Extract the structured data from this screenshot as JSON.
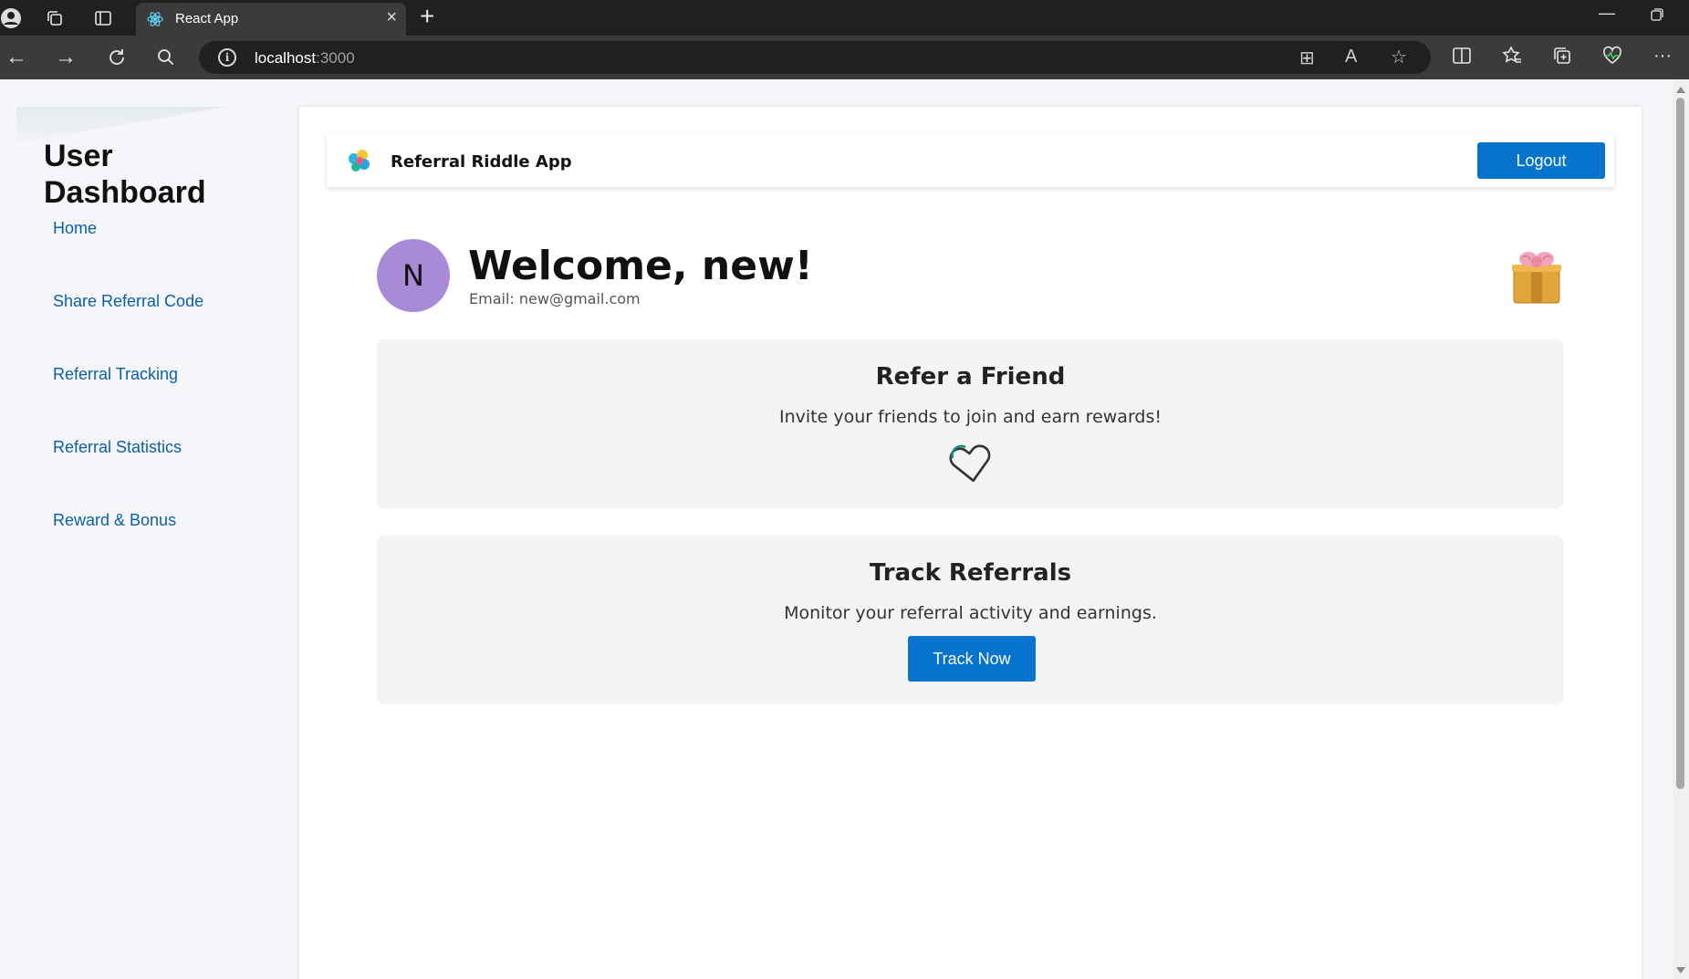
{
  "browser": {
    "tab_title": "React App",
    "url_host": "localhost",
    "url_port": ":3000"
  },
  "sidebar": {
    "title": "User Dashboard",
    "items": [
      {
        "label": "Home"
      },
      {
        "label": "Share Referral Code"
      },
      {
        "label": "Referral Tracking"
      },
      {
        "label": "Referral Statistics"
      },
      {
        "label": "Reward & Bonus"
      }
    ]
  },
  "header": {
    "app_name": "Referral Riddle App",
    "logout_label": "Logout"
  },
  "user": {
    "initial": "N",
    "welcome": "Welcome, new!",
    "email": "Email: new@gmail.com"
  },
  "cards": [
    {
      "title": "Refer a Friend",
      "text": "Invite your friends to join and earn rewards!",
      "icon": "heart-outline-icon"
    },
    {
      "title": "Track Referrals",
      "text": "Monitor your referral activity and earnings.",
      "button_label": "Track Now"
    }
  ],
  "colors": {
    "primary": "#0673cf",
    "avatar": "#a98ad6",
    "link": "#0d5fa6"
  }
}
